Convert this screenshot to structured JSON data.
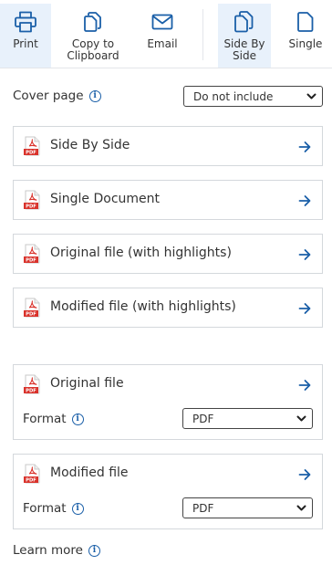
{
  "toolbar": {
    "print": "Print",
    "copy_line1": "Copy to",
    "copy_line2": "Clipboard",
    "email": "Email",
    "side_line1": "Side By",
    "side_line2": "Side",
    "single": "Single"
  },
  "cover": {
    "label": "Cover page",
    "selected": "Do not include"
  },
  "options": [
    {
      "title": "Side By Side"
    },
    {
      "title": "Single Document"
    },
    {
      "title": "Original file (with highlights)"
    },
    {
      "title": "Modified file (with highlights)"
    }
  ],
  "downloads": [
    {
      "title": "Original file",
      "format_label": "Format",
      "format_value": "PDF"
    },
    {
      "title": "Modified file",
      "format_label": "Format",
      "format_value": "PDF"
    }
  ],
  "pdf_badge": "PDF",
  "learn_more": "Learn more",
  "colors": {
    "accent": "#1a5fa8",
    "active_bg": "#e8f1fb",
    "pdf_red": "#d9322b",
    "border": "#d4d8dc"
  }
}
